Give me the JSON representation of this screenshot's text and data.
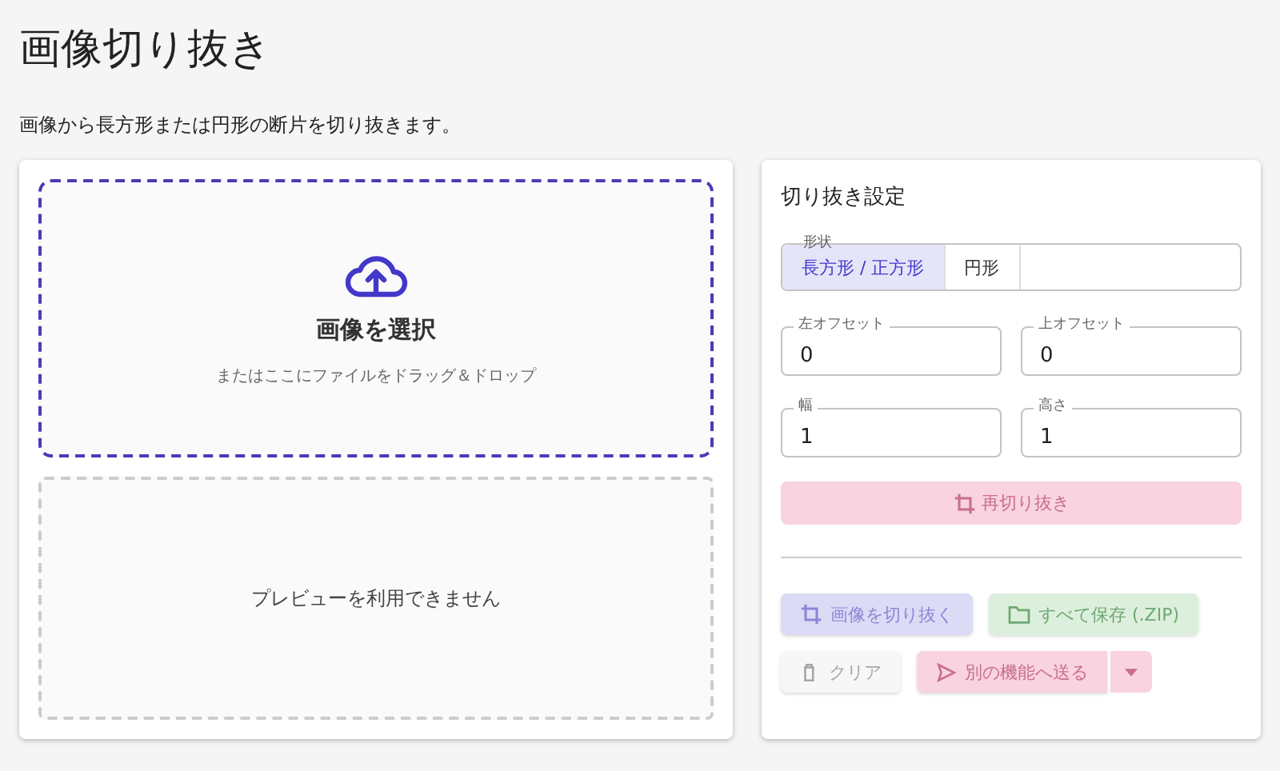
{
  "page": {
    "title": "画像切り抜き",
    "description": "画像から長方形または円形の断片を切り抜きます。"
  },
  "dropzone": {
    "title": "画像を選択",
    "hint": "またはここにファイルをドラッグ＆ドロップ"
  },
  "preview": {
    "message": "プレビューを利用できません"
  },
  "settings": {
    "title": "切り抜き設定",
    "shape": {
      "label": "形状",
      "options": [
        {
          "label": "長方形 / 正方形",
          "selected": true
        },
        {
          "label": "円形",
          "selected": false
        }
      ]
    },
    "fields": [
      {
        "label": "左オフセット",
        "value": "0"
      },
      {
        "label": "上オフセット",
        "value": "0"
      },
      {
        "label": "幅",
        "value": "1"
      },
      {
        "label": "高さ",
        "value": "1"
      }
    ],
    "recrop_button": {
      "label": "再切り抜き",
      "disabled": true
    },
    "actions": [
      {
        "label": "画像を切り抜く",
        "kind": "crop",
        "disabled": true
      },
      {
        "label": "すべて保存 (.ZIP)",
        "kind": "save",
        "disabled": true
      },
      {
        "label": "クリア",
        "kind": "clear",
        "disabled": true
      },
      {
        "label": "別の機能へ送る",
        "kind": "send",
        "disabled": true
      }
    ]
  }
}
